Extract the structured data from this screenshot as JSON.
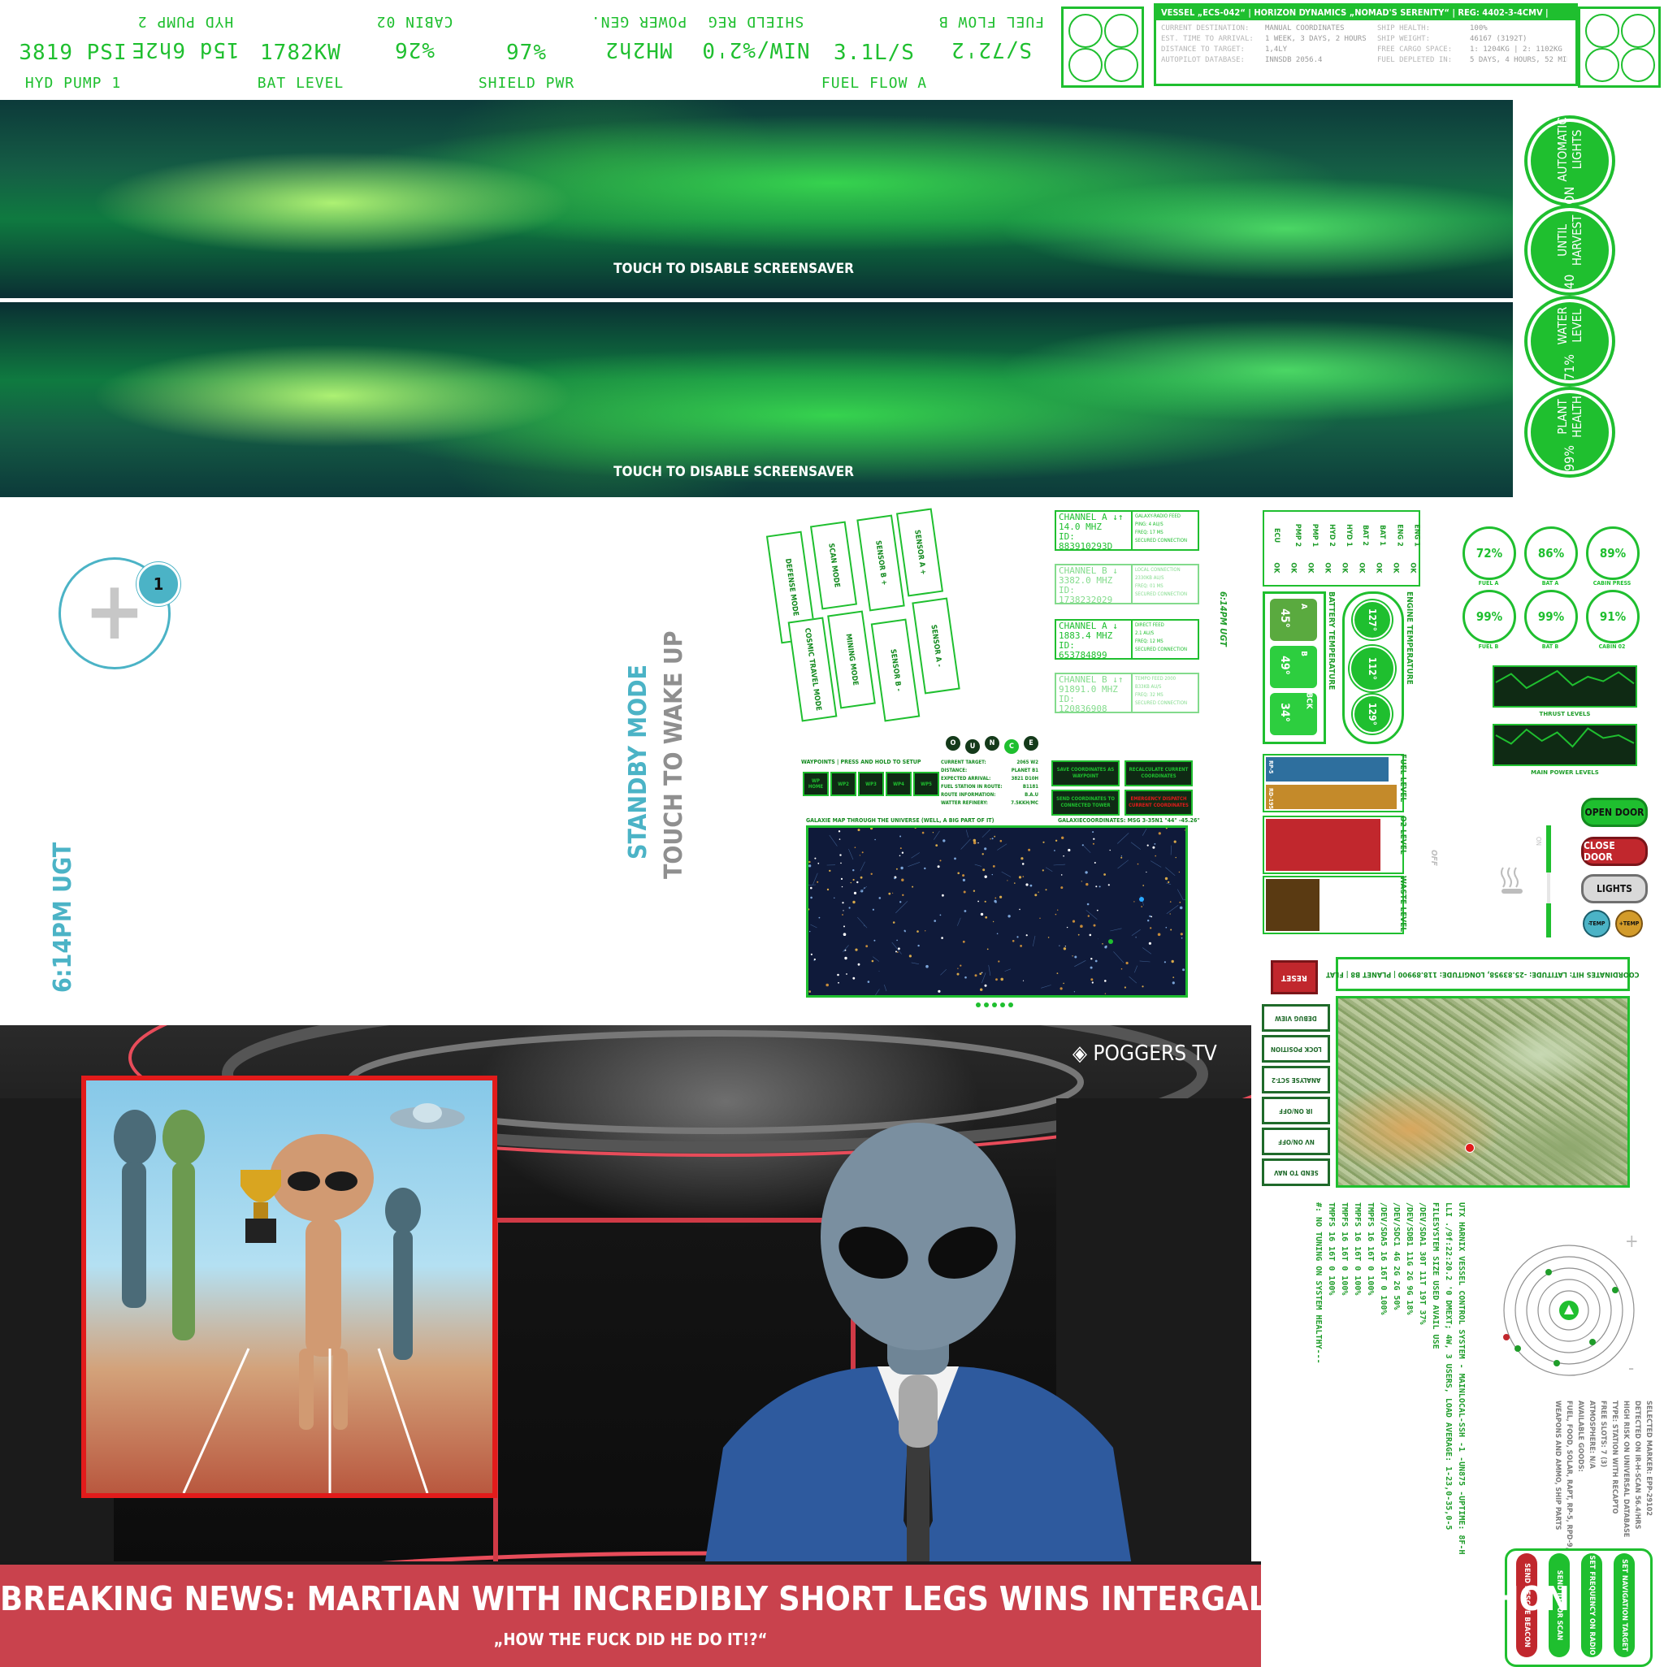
{
  "top_readouts": [
    {
      "value": "3819 PSI",
      "label": "HYD PUMP 1",
      "flipped": false
    },
    {
      "value": "15d 6h2E",
      "label": "HYD PUMP 2",
      "flipped": true
    },
    {
      "value": "1782KW",
      "label": "BAT LEVEL",
      "flipped": false
    },
    {
      "value": "%26",
      "label": "CABIN 02",
      "flipped": true
    },
    {
      "value": "97%",
      "label": "SHIELD PWR",
      "flipped": false
    },
    {
      "value": "MH2h2",
      "label": "POWER GEN.",
      "flipped": true
    },
    {
      "value": "NIW/%2'0",
      "label": "SHIELD REG",
      "flipped": true
    },
    {
      "value": "3.1L/S",
      "label": "FUEL FLOW A",
      "flipped": false
    },
    {
      "value": "S/72'2",
      "label": "FUEL FLOW B",
      "flipped": true
    }
  ],
  "vessel_panel": {
    "header": "VESSEL „ECS-042“ | HORIZON DYNAMICS „NOMAD'S SERENITY“ | REG: 4402-3-4CMV | CLASS D SPACESHIP",
    "rows": [
      [
        "CURRENT DESTINATION:",
        "MANUAL COORDINATES",
        "SHIP HEALTH:",
        "100%"
      ],
      [
        "EST. TIME TO ARRIVAL:",
        "1 WEEK, 3 DAYS, 2 HOURS",
        "SHIP WEIGHT:",
        "46167 (3192T)"
      ],
      [
        "DISTANCE TO TARGET:",
        "1,4LY",
        "FREE CARGO SPACE:",
        "1: 1204KG | 2: 1102KG"
      ],
      [
        "AUTOPILOT DATABASE:",
        "INNSDB 2056.4",
        "FUEL DEPLETED IN:",
        "5 DAYS, 4 HOURS, 52 MIN"
      ]
    ]
  },
  "screensaver": {
    "text": "TOUCH TO DISABLE SCREENSAVER"
  },
  "status_circles": [
    {
      "value": "ON",
      "label": "AUTOMATIC LIGHTS"
    },
    {
      "value": "40",
      "label": "UNTIL HARVEST"
    },
    {
      "value": "71%",
      "label": "WATER LEVEL"
    },
    {
      "value": "99%",
      "label": "PLANT HEALTH"
    }
  ],
  "add_widget": {
    "badge": "1",
    "symbol": "+"
  },
  "standby": {
    "title": "STANDBY MODE",
    "subtitle": "TOUCH TO WAKE UP"
  },
  "clock": {
    "time": "6:14PM UGT",
    "small": "6:14PM UGT"
  },
  "mode_buttons": [
    "DEFENSE MODE",
    "SCAN MODE",
    "SENSOR B +",
    "SENSOR A +",
    "COSMIC TRAVEL MODE",
    "MINING MODE",
    "SENSOR B -",
    "SENSOR A -"
  ],
  "channels": [
    {
      "name": "CHANNEL A ↓↑",
      "freq": "14.0 MHZ",
      "id": "ID: 883910293D",
      "info": [
        "GALAXY-RADIO FEED",
        "PING: 4 AU/S",
        "FREQ: 17 MS",
        "SECURED CONNECTION"
      ]
    },
    {
      "name": "CHANNEL B ↓",
      "freq": "3382.0 MHZ",
      "id": "ID: 1738232029",
      "info": [
        "LOCAL CONNECTION",
        "2330KB AU/S",
        "FREQ: 01 MS",
        "SECURED CONNECTION"
      ]
    },
    {
      "name": "CHANNEL A ↓",
      "freq": "1883.4 MHZ",
      "id": "ID: 653784899",
      "info": [
        "DIRECT FEED",
        "2.1 AU/S",
        "FREQ: 12 MS",
        "SECURED CONNECTION"
      ]
    },
    {
      "name": "CHANNEL B ↓↑",
      "freq": "91891.0 MHZ",
      "id": "ID: 120836908",
      "info": [
        "TEMPO FEED 2000",
        "B33KB AU/S",
        "FREQ: 32 MS",
        "SECURED CONNECTION"
      ]
    }
  ],
  "system_table": {
    "headers": [
      "ENG 1",
      "ENG 2",
      "BAT 1",
      "BAT 2",
      "HYD 1",
      "HYD 2",
      "PMP 1",
      "PMP 2",
      "ECU"
    ],
    "values": [
      "OK",
      "OK",
      "OK",
      "OK",
      "OK",
      "OK",
      "OK",
      "OK",
      "OK"
    ]
  },
  "small_gauges": [
    {
      "value": "72%",
      "label": "FUEL A"
    },
    {
      "value": "86%",
      "label": "BAT A"
    },
    {
      "value": "89%",
      "label": "CABIN PRESS"
    },
    {
      "value": "99%",
      "label": "FUEL B"
    },
    {
      "value": "99%",
      "label": "BAT B"
    },
    {
      "value": "91%",
      "label": "CABIN 02"
    }
  ],
  "battery_temp": {
    "label": "BATTERY TEMPERATURE",
    "cells": [
      {
        "name": "A",
        "value": "45°"
      },
      {
        "name": "B",
        "value": "49°"
      },
      {
        "name": "BCK",
        "value": "34°"
      }
    ]
  },
  "engine_temp": {
    "label": "ENGINE TEMPERATURE",
    "values": [
      "127°",
      "112°",
      "129°"
    ]
  },
  "line_charts": [
    {
      "label": "THRUST LEVELS",
      "values": [
        40,
        55,
        30,
        45,
        60,
        35,
        50,
        42,
        58,
        38
      ]
    },
    {
      "label": "MAIN POWER LEVELS",
      "values": [
        50,
        35,
        60,
        40,
        55,
        30,
        62,
        45,
        50,
        36
      ]
    }
  ],
  "levels": [
    {
      "label": "FUEL LEVEL",
      "bars": [
        {
          "name": "RP-5",
          "fill": 0.92,
          "color": "#2e6f9e"
        },
        {
          "name": "RD-195",
          "fill": 0.98,
          "color": "#c48a2a"
        }
      ]
    },
    {
      "label": "O2 LEVEL",
      "bars": [
        {
          "name": "",
          "fill": 0.86,
          "color": "#c1272d"
        }
      ]
    },
    {
      "label": "WASTE LEVEL",
      "bars": [
        {
          "name": "",
          "fill": 0.4,
          "color": "#5a3a12"
        }
      ]
    }
  ],
  "door_controls": {
    "open": "OPEN DOOR",
    "close": "CLOSE DOOR",
    "lights": "LIGHTS",
    "temp_down": "-TEMP",
    "temp_up": "+TEMP",
    "off": "OFF",
    "on": "ON"
  },
  "nav_panel": {
    "letters": [
      "O",
      "U",
      "N",
      "C",
      "E"
    ],
    "title": "WAYPOINTS | PRESS AND HOLD TO SETUP",
    "waypoints": [
      "WP HOME",
      "WP2",
      "WP3",
      "WP4",
      "WP5"
    ],
    "details": [
      [
        "CURRENT TARGET:",
        "2065 W2"
      ],
      [
        "DISTANCE:",
        "PLANET B1"
      ],
      [
        "EXPECTED ARRIVAL:",
        "3821 D10H"
      ],
      [
        "FUEL STATION IN ROUTE:",
        "B1181"
      ],
      [
        "ROUTE INFORMATION:",
        "B.A.U"
      ],
      [
        "WATTER REFINERY:",
        "7.5KKH/MC"
      ]
    ],
    "actions": [
      "SAVE COORDINATES AS WAYPOINT",
      "RECALCULATE CURRENT COORDINATES",
      "SEND COORDINATES TO CONNECTED TOWER",
      "EMERGENCY DISPATCH CURRENT COORDINATES"
    ],
    "map_title": "GALAXIE MAP THROUGH THE UNIVERSE (WELL, A BIG PART OF IT)",
    "map_coords": "GALAXIECOORDINATES: MSG 3-35N1 \"44\" -45.26\""
  },
  "coordinates": {
    "reset": "RESET",
    "text": "COORDINATES HIT: LATITUDE: -25.83958, LONGITUDE: 118.89900 | PLANET B8 | FLAT"
  },
  "side_buttons": [
    "DEBUG VIEW",
    "LOCK POSITION",
    "ANALYSE SCT-2",
    "IR ON/OFF",
    "NV ON/OFF",
    "SEND TO NAV"
  ],
  "terminal": [
    "UTX HARNIX VESSEL CONTROL SYSTEM - MAINLOCAL-SSH -1 -UN875 -UPTIME: 8F-H",
    "LLI ./9f:22:20.2 '0 DMEXT; 4W, 3 USERS, LOAD AVERAGE: 1-23,0-35,0-5",
    "FILESYSTEM SIZE USED AVAIL USE",
    "/DEV/SDA1 30T 11T 19T 37%",
    "/DEV/SDB1 11G 2G 9G 18%",
    "/DEV/SDC1 4G 2G 2G 50%",
    "/DEV/SDA5 16 16T 0 100%",
    "TMPFS 16 16T 0 100%",
    "TMPFS 16 16T 0 100%",
    "TMPFS 16 16T 0 100%",
    "TMPFS 16 16T 0 100%",
    "#: NO TUNING ON SYSTEM HEALTHY---"
  ],
  "radar": {
    "plus": "+",
    "minus": "-"
  },
  "selected_marker": [
    "SELECTED MARKER: EPP-29102",
    "DETECTED ON IR-H-SCAN 56.4/HRS",
    "HIGH RISK ON UNIVERSAL DATABASE",
    "TYPE: STATION WITH RECAPTO",
    "FREE SLOTS: 7 (3)",
    "ATMOSPHERE: N/A",
    "AVAILABLE GOODS:",
    "FUEL, FOOD, SOLAR, RAPT, RP-5, RPD-9,",
    "WEAPONS AND AMMO, SHIP PARTS"
  ],
  "bottom_actions": [
    "SEND RESCUE BEACON",
    "SEND ID FOR SCAN",
    "SET FREQUENCY ON RADIO",
    "SET NAVIGATION TARGET"
  ],
  "news": {
    "channel": "POGGERS TV",
    "headline": "BREAKING NEWS: MARTIAN WITH INCREDIBLY SHORT LEGS WINS INTERGALACTIC MARATHON",
    "quote": "„HOW THE FUCK DID HE DO IT!?“"
  },
  "colors": {
    "accent": "#1fbf2f",
    "dark_green": "#138a1f",
    "news_red": "#c9424d",
    "teal": "#4bb3c6",
    "red": "#c1272d"
  }
}
